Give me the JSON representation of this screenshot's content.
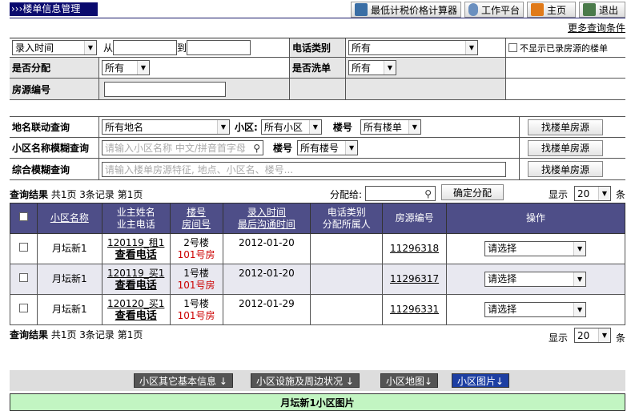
{
  "page_title": "楼单信息管理",
  "toolbar": {
    "calc": "最低计税价格计算器",
    "workbench": "工作平台",
    "home": "主页",
    "logout": "退出"
  },
  "more_search": "更多查询条件",
  "filters": {
    "time_type": "录入时间",
    "from_label": "从",
    "to_label": "到",
    "phone_type_label": "电话类别",
    "phone_type_value": "所有",
    "hide_sold_label": "不显示已录房源的楼单",
    "assigned_label": "是否分配",
    "assigned_value": "所有",
    "washed_label": "是否洗单",
    "washed_value": "所有",
    "source_no_label": "房源编号",
    "place_label": "地名联动查询",
    "place_value": "所有地名",
    "district_label": "小区:",
    "district_value": "所有小区",
    "building_label": "楼号",
    "building_value": "所有楼单",
    "find_btn": "找楼单房源",
    "fuzzy_label": "小区名称模糊查询",
    "fuzzy_placeholder": "请输入小区名称 中文/拼音首字母",
    "building_label2": "楼号",
    "building_value2": "所有楼号",
    "combo_label": "综合模糊查询",
    "combo_placeholder": "请输入楼单房源特征, 地点、小区名、楼号..."
  },
  "summary": {
    "label": "查询结果",
    "text": "共1页 3条记录 第1页"
  },
  "assign": {
    "label": "分配给:",
    "button": "确定分配"
  },
  "pagesize": {
    "label": "显示",
    "value": "20",
    "unit": "条"
  },
  "table": {
    "headers": {
      "name": "小区名称",
      "owner": "业主姓名",
      "owner2": "业主电话",
      "building": "楼号",
      "building2": "房间号",
      "time": "录入时间",
      "time2": "最后沟通时间",
      "phone": "电话类别",
      "phone2": "分配所属人",
      "source": "房源编号",
      "action": "操作"
    },
    "rows": [
      {
        "name": "月坛新1",
        "owner": "120119_租1",
        "phone_link": "查看电话",
        "building": "2号楼",
        "room": "101号房",
        "time": "2012-01-20",
        "source": "11296318",
        "action": "请选择"
      },
      {
        "name": "月坛新1",
        "owner": "120119_买1",
        "phone_link": "查看电话",
        "building": "1号楼",
        "room": "101号房",
        "time": "2012-01-20",
        "source": "11296317",
        "action": "请选择"
      },
      {
        "name": "月坛新1",
        "owner": "120120_买1",
        "phone_link": "查看电话",
        "building": "1号楼",
        "room": "101号房",
        "time": "2012-01-29",
        "source": "11296331",
        "action": "请选择"
      }
    ]
  },
  "tabs": {
    "basic": "小区其它基本信息 ↓",
    "facility": "小区设施及周边状况 ↓",
    "map": "小区地图↓",
    "photo": "小区图片↓"
  },
  "photo_title": "月坛新1小区图片",
  "colors": {
    "header_bg": "#4e4e88",
    "title_bg": "#0a0a6e",
    "photo_bg": "#c2f5c2",
    "room_red": "#cc0000"
  }
}
